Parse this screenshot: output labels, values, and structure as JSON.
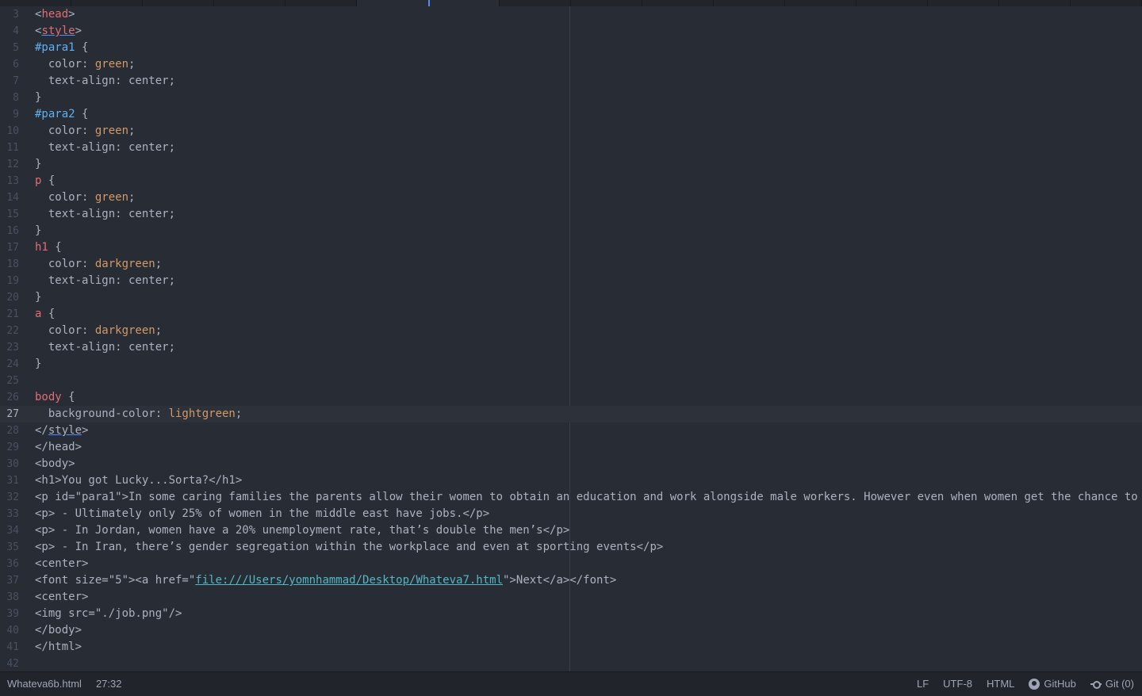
{
  "editor": {
    "lines": [
      {
        "n": "3",
        "segs": [
          [
            "<",
            ""
          ],
          [
            "head",
            "tag"
          ],
          [
            ">",
            ""
          ]
        ]
      },
      {
        "n": "4",
        "segs": [
          [
            "<",
            ""
          ],
          [
            "style",
            "tag und"
          ],
          [
            ">",
            ""
          ]
        ]
      },
      {
        "n": "5",
        "segs": [
          [
            "#para1",
            "sel-id"
          ],
          [
            " {",
            ""
          ]
        ]
      },
      {
        "n": "6",
        "segs": [
          [
            "  color: ",
            ""
          ],
          [
            "green",
            "kw"
          ],
          [
            ";",
            ""
          ]
        ]
      },
      {
        "n": "7",
        "segs": [
          [
            "  text-align: center;",
            ""
          ]
        ]
      },
      {
        "n": "8",
        "segs": [
          [
            "}",
            ""
          ]
        ]
      },
      {
        "n": "9",
        "segs": [
          [
            "#para2",
            "sel-id"
          ],
          [
            " {",
            ""
          ]
        ]
      },
      {
        "n": "10",
        "segs": [
          [
            "  color: ",
            ""
          ],
          [
            "green",
            "kw"
          ],
          [
            ";",
            ""
          ]
        ]
      },
      {
        "n": "11",
        "segs": [
          [
            "  text-align: center;",
            ""
          ]
        ]
      },
      {
        "n": "12",
        "segs": [
          [
            "}",
            ""
          ]
        ]
      },
      {
        "n": "13",
        "segs": [
          [
            "p",
            "tag"
          ],
          [
            " {",
            ""
          ]
        ]
      },
      {
        "n": "14",
        "segs": [
          [
            "  color: ",
            ""
          ],
          [
            "green",
            "kw"
          ],
          [
            ";",
            ""
          ]
        ]
      },
      {
        "n": "15",
        "segs": [
          [
            "  text-align: center;",
            ""
          ]
        ]
      },
      {
        "n": "16",
        "segs": [
          [
            "}",
            ""
          ]
        ]
      },
      {
        "n": "17",
        "segs": [
          [
            "h1",
            "tag"
          ],
          [
            " {",
            ""
          ]
        ]
      },
      {
        "n": "18",
        "segs": [
          [
            "  color: ",
            ""
          ],
          [
            "darkgreen",
            "kw"
          ],
          [
            ";",
            ""
          ]
        ]
      },
      {
        "n": "19",
        "segs": [
          [
            "  text-align: center;",
            ""
          ]
        ]
      },
      {
        "n": "20",
        "segs": [
          [
            "}",
            ""
          ]
        ]
      },
      {
        "n": "21",
        "segs": [
          [
            "a",
            "tag"
          ],
          [
            " {",
            ""
          ]
        ]
      },
      {
        "n": "22",
        "segs": [
          [
            "  color: ",
            ""
          ],
          [
            "darkgreen",
            "kw"
          ],
          [
            ";",
            ""
          ]
        ]
      },
      {
        "n": "23",
        "segs": [
          [
            "  text-align: center;",
            ""
          ]
        ]
      },
      {
        "n": "24",
        "segs": [
          [
            "}",
            ""
          ]
        ]
      },
      {
        "n": "25",
        "segs": []
      },
      {
        "n": "26",
        "segs": [
          [
            "body",
            "tag"
          ],
          [
            " {",
            ""
          ]
        ]
      },
      {
        "n": "27",
        "cursor": true,
        "segs": [
          [
            "  background-color: ",
            ""
          ],
          [
            "lightgreen",
            "kw"
          ],
          [
            ";",
            ""
          ]
        ]
      },
      {
        "n": "28",
        "segs": [
          [
            "</",
            ""
          ],
          [
            "style",
            "und"
          ],
          [
            ">",
            ""
          ]
        ]
      },
      {
        "n": "29",
        "segs": [
          [
            "</head>",
            ""
          ]
        ]
      },
      {
        "n": "30",
        "segs": [
          [
            "<body>",
            ""
          ]
        ]
      },
      {
        "n": "31",
        "segs": [
          [
            "<h1>You got Lucky...Sorta?</h1>",
            ""
          ]
        ]
      },
      {
        "n": "32",
        "segs": [
          [
            "<p id=\"para1\">In some caring families the parents allow their women to obtain an education and work alongside male workers. However even when women get the chance to",
            ""
          ]
        ]
      },
      {
        "n": "33",
        "segs": [
          [
            "<p> - Ultimately only 25% of women in the middle east have jobs.</p>",
            ""
          ]
        ]
      },
      {
        "n": "34",
        "segs": [
          [
            "<p> - In Jordan, women have a 20% unemployment rate, that’s double the men’s</p>",
            ""
          ]
        ]
      },
      {
        "n": "35",
        "segs": [
          [
            "<p> - In Iran, there’s gender segregation within the workplace and even at sporting events</p>",
            ""
          ]
        ]
      },
      {
        "n": "36",
        "segs": [
          [
            "<center>",
            ""
          ]
        ]
      },
      {
        "n": "37",
        "segs": [
          [
            "<font size=\"5\"><a href=\"",
            ""
          ],
          [
            "file:///Users/yomnhammad/Desktop/Whateva7.html",
            "link"
          ],
          [
            "\">Next</a></font>",
            ""
          ]
        ]
      },
      {
        "n": "38",
        "segs": [
          [
            "<center>",
            ""
          ]
        ]
      },
      {
        "n": "39",
        "segs": [
          [
            "<img src=\"./job.png\"/>",
            ""
          ]
        ]
      },
      {
        "n": "40",
        "segs": [
          [
            "</body>",
            ""
          ]
        ]
      },
      {
        "n": "41",
        "segs": [
          [
            "</html>",
            ""
          ]
        ]
      },
      {
        "n": "42",
        "segs": []
      }
    ]
  },
  "status": {
    "filename": "Whateva6b.html",
    "cursor_pos": "27:32",
    "line_ending": "LF",
    "encoding": "UTF-8",
    "grammar": "HTML",
    "github": "GitHub",
    "git": "Git (0)"
  }
}
